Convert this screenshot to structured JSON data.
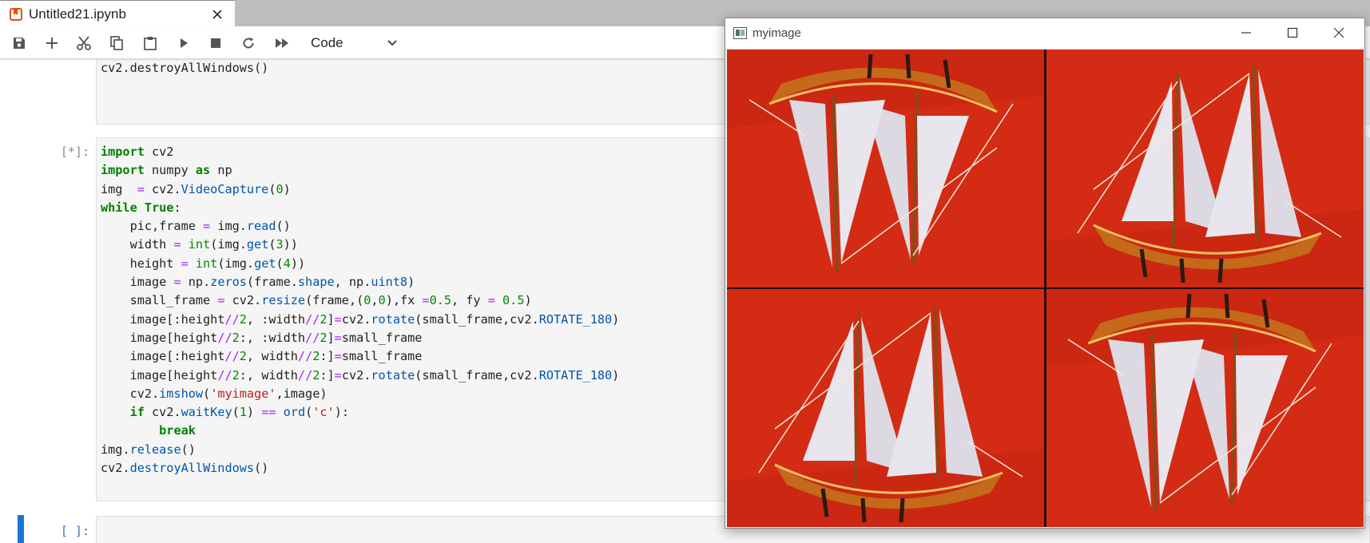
{
  "tab": {
    "title": "Untitled21.ipynb",
    "icon": "notebook-icon"
  },
  "toolbar": {
    "buttons": [
      "save-icon",
      "add-icon",
      "cut-icon",
      "copy-icon",
      "paste-icon",
      "run-icon",
      "stop-icon",
      "restart-icon",
      "run-all-icon"
    ],
    "cell_type": "Code"
  },
  "cells": [
    {
      "prompt": "",
      "code_tail": "cv2.destroyAllWindows()"
    },
    {
      "prompt": "[*]:"
    },
    {
      "prompt": "[ ]:"
    }
  ],
  "cv_window": {
    "title": "myimage",
    "image_quadrants": [
      "ship-rotated-180",
      "ship-normal",
      "ship-normal",
      "ship-rotated-180"
    ],
    "colors": {
      "background": "#d42b14",
      "hull": "#c46a1a",
      "sail": "#e8e6ec"
    }
  }
}
